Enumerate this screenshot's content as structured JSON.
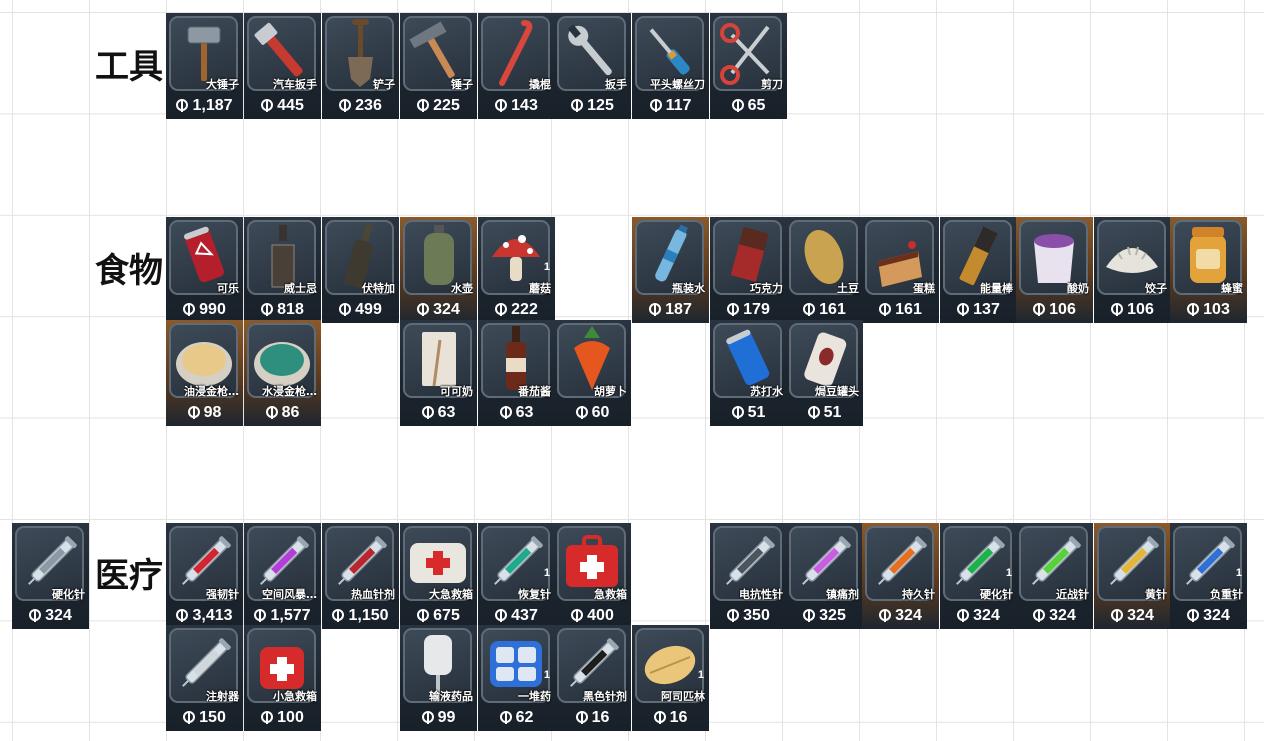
{
  "categories": {
    "tools": "工具",
    "food": "食物",
    "medical": "医疗"
  },
  "tools": [
    {
      "name": "大锤子",
      "price": "1,187",
      "icon": "sledgehammer-icon"
    },
    {
      "name": "汽车扳手",
      "price": "445",
      "icon": "pipe-wrench-icon"
    },
    {
      "name": "铲子",
      "price": "236",
      "icon": "shovel-icon"
    },
    {
      "name": "锤子",
      "price": "225",
      "icon": "hammer-icon"
    },
    {
      "name": "撬棍",
      "price": "143",
      "icon": "crowbar-icon"
    },
    {
      "name": "扳手",
      "price": "125",
      "icon": "wrench-icon"
    },
    {
      "name": "平头螺丝刀",
      "price": "117",
      "icon": "screwdriver-icon"
    },
    {
      "name": "剪刀",
      "price": "65",
      "icon": "scissors-icon"
    }
  ],
  "food": [
    {
      "name": "可乐",
      "price": "990",
      "icon": "cola-can-icon"
    },
    {
      "name": "威士忌",
      "price": "818",
      "icon": "whiskey-bottle-icon"
    },
    {
      "name": "伏特加",
      "price": "499",
      "icon": "vodka-bottle-icon"
    },
    {
      "name": "水壶",
      "price": "324",
      "icon": "canteen-icon"
    },
    {
      "name": "蘑菇",
      "price": "222",
      "icon": "mushroom-icon",
      "badge": "1"
    },
    {
      "name": "瓶装水",
      "price": "187",
      "icon": "water-bottle-icon"
    },
    {
      "name": "巧克力",
      "price": "179",
      "icon": "chocolate-icon"
    },
    {
      "name": "土豆",
      "price": "161",
      "icon": "potato-icon"
    },
    {
      "name": "蛋糕",
      "price": "161",
      "icon": "cake-icon"
    },
    {
      "name": "能量棒",
      "price": "137",
      "icon": "energy-bar-icon"
    },
    {
      "name": "酸奶",
      "price": "106",
      "icon": "yogurt-icon"
    },
    {
      "name": "饺子",
      "price": "106",
      "icon": "dumpling-icon"
    },
    {
      "name": "蜂蜜",
      "price": "103",
      "icon": "honey-jar-icon"
    },
    {
      "name": "油浸金枪…",
      "price": "98",
      "icon": "tuna-can-oil-icon"
    },
    {
      "name": "水浸金枪…",
      "price": "86",
      "icon": "tuna-can-water-icon"
    },
    {
      "name": "可可奶",
      "price": "63",
      "icon": "cocoa-milk-icon"
    },
    {
      "name": "番茄酱",
      "price": "63",
      "icon": "ketchup-icon"
    },
    {
      "name": "胡萝卜",
      "price": "60",
      "icon": "carrot-icon"
    },
    {
      "name": "苏打水",
      "price": "51",
      "icon": "soda-can-icon"
    },
    {
      "name": "焗豆罐头",
      "price": "51",
      "icon": "baked-beans-can-icon"
    }
  ],
  "medical_left": {
    "name": "硬化针",
    "price": "324",
    "icon": "syringe-grey-icon"
  },
  "medical": [
    {
      "name": "强韧针",
      "price": "3,413",
      "icon": "syringe-red-icon"
    },
    {
      "name": "空间风暴…",
      "price": "1,577",
      "icon": "syringe-purple-icon"
    },
    {
      "name": "热血针剂",
      "price": "1,150",
      "icon": "syringe-red2-icon"
    },
    {
      "name": "大急救箱",
      "price": "675",
      "icon": "large-medkit-icon"
    },
    {
      "name": "恢复针",
      "price": "437",
      "icon": "syringe-teal-icon",
      "badge": "1"
    },
    {
      "name": "急救箱",
      "price": "400",
      "icon": "medkit-icon"
    },
    {
      "name": "电抗性针",
      "price": "350",
      "icon": "syringe-dark-icon"
    },
    {
      "name": "镇痛剂",
      "price": "325",
      "icon": "syringe-pink-icon"
    },
    {
      "name": "持久针",
      "price": "324",
      "icon": "syringe-orange-icon"
    },
    {
      "name": "硬化针",
      "price": "324",
      "icon": "syringe-green-icon",
      "badge": "1"
    },
    {
      "name": "近战针",
      "price": "324",
      "icon": "syringe-lime-icon"
    },
    {
      "name": "黄针",
      "price": "324",
      "icon": "syringe-yellow-icon"
    },
    {
      "name": "负重针",
      "price": "324",
      "icon": "syringe-blue-icon",
      "badge": "1"
    },
    {
      "name": "注射器",
      "price": "150",
      "icon": "syringe-empty-icon"
    },
    {
      "name": "小急救箱",
      "price": "100",
      "icon": "small-medkit-icon"
    },
    {
      "name": "输液药品",
      "price": "99",
      "icon": "iv-bag-icon"
    },
    {
      "name": "一堆药",
      "price": "62",
      "icon": "pill-box-icon",
      "badge": "1"
    },
    {
      "name": "黑色针剂",
      "price": "16",
      "icon": "syringe-black-icon"
    },
    {
      "name": "阿司匹林",
      "price": "16",
      "icon": "aspirin-icon",
      "badge": "1"
    }
  ]
}
